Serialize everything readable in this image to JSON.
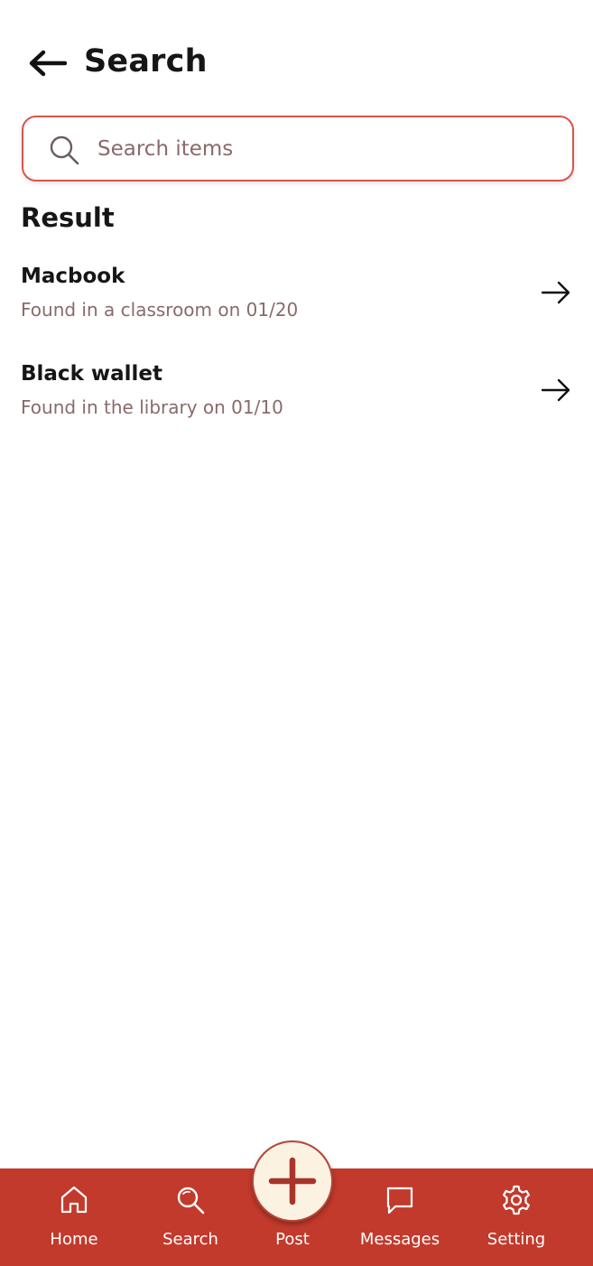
{
  "header": {
    "title": "Search",
    "back_icon": "arrow-left-icon"
  },
  "search": {
    "placeholder": "Search items",
    "value": "",
    "icon": "search-icon",
    "border_color": "#d9554a"
  },
  "results": {
    "heading": "Result",
    "items": [
      {
        "title": "Macbook",
        "subtitle": "Found in a classroom on 01/20",
        "icon": "arrow-right-icon"
      },
      {
        "title": "Black wallet",
        "subtitle": "Found in the library on 01/10",
        "icon": "arrow-right-icon"
      }
    ]
  },
  "bottom_nav": {
    "background": "#c23a2c",
    "items": [
      {
        "label": "Home",
        "icon": "home-icon"
      },
      {
        "label": "Search",
        "icon": "search-icon"
      },
      {
        "label": "Post",
        "icon": "plus-icon"
      },
      {
        "label": "Messages",
        "icon": "message-icon"
      },
      {
        "label": "Setting",
        "icon": "gear-icon"
      }
    ]
  }
}
